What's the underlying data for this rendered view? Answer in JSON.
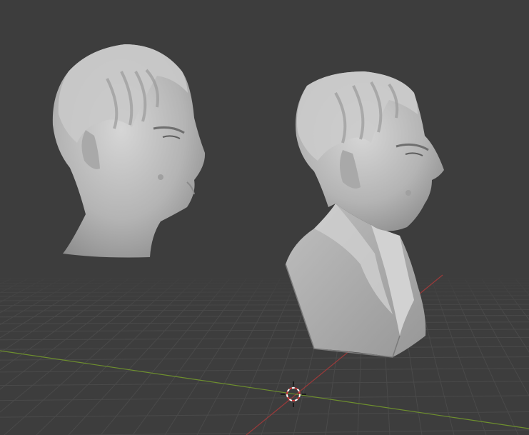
{
  "viewport": {
    "background": "#3d3d3d",
    "grid_color": "#4a4a4a",
    "x_axis_color": "#9a3a3a",
    "y_axis_color": "#6e8f2e"
  },
  "objects": [
    {
      "name": "head-sculpt",
      "material_color": "#bdbdbd"
    },
    {
      "name": "bust-sculpt",
      "material_color": "#bdbdbd"
    }
  ],
  "cursor": {
    "icon": "3d-cursor-icon"
  }
}
